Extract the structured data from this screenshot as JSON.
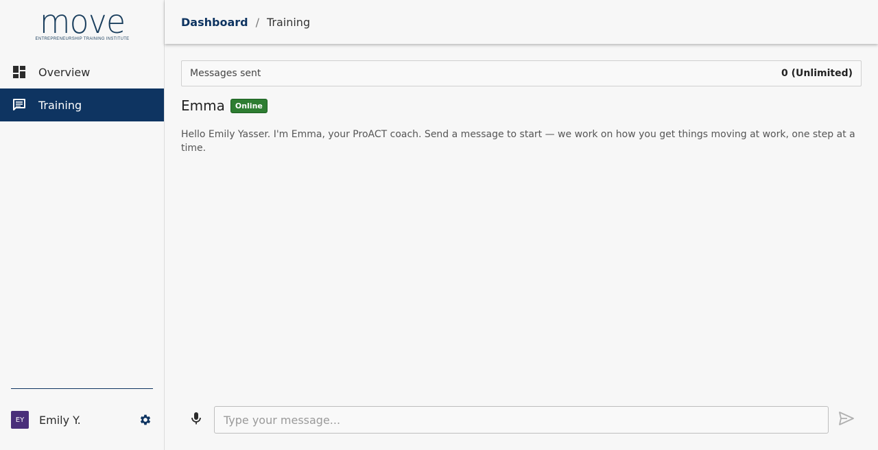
{
  "brand": {
    "logo_text": "move",
    "logo_subtitle": "ENTREPRENEURSHIP TRAINING INSTITUTE"
  },
  "sidebar": {
    "items": [
      {
        "label": "Overview",
        "icon": "dashboard-icon",
        "active": false
      },
      {
        "label": "Training",
        "icon": "chat-icon",
        "active": true
      }
    ],
    "user": {
      "initials": "EY",
      "name": "Emily Y.",
      "settings_icon": "gear-icon"
    }
  },
  "header": {
    "breadcrumb_root": "Dashboard",
    "breadcrumb_separator": "/",
    "breadcrumb_current": "Training"
  },
  "counter": {
    "label": "Messages sent",
    "value": "0 (Unlimited)"
  },
  "coach": {
    "name": "Emma",
    "status": "Online",
    "greeting": "Hello Emily Yasser. I'm Emma, your ProACT coach. Send a message to start — we work on how you get things moving at work, one step at a time."
  },
  "composer": {
    "placeholder": "Type your message...",
    "value": "",
    "mic_icon": "microphone-icon",
    "send_icon": "send-icon"
  },
  "colors": {
    "primary": "#0e3461",
    "online": "#2e7d32",
    "avatar": "#4a2f7a",
    "background": "#f7f7f7"
  }
}
